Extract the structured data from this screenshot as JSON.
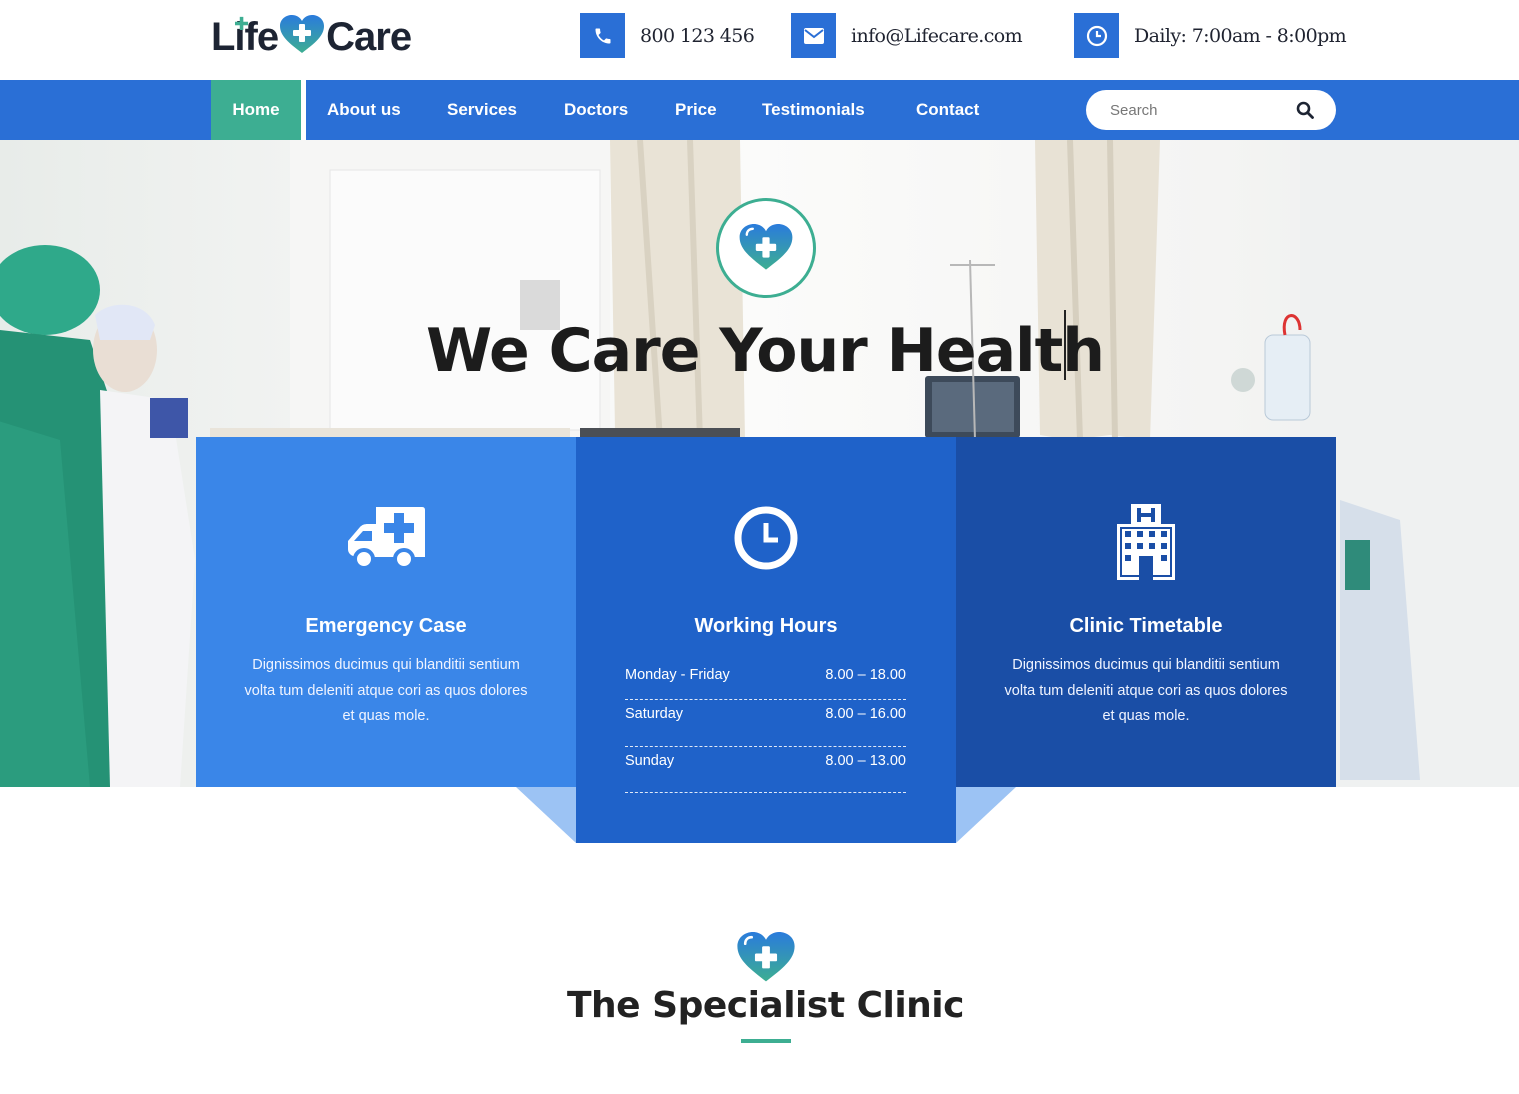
{
  "brand": {
    "logo_left": "Life",
    "logo_right": "Care"
  },
  "contacts": {
    "phone": "800 123 456",
    "email": "info@Lifecare.com",
    "hours": "Daily: 7:00am - 8:00pm"
  },
  "nav": {
    "items": [
      "Home",
      "About us",
      "Services",
      "Doctors",
      "Price",
      "Testimonials",
      "Contact"
    ],
    "active": "Home"
  },
  "search": {
    "placeholder": "Search"
  },
  "hero": {
    "title": "We Care Your Health"
  },
  "cards": [
    {
      "title": "Emergency Case",
      "text": "Dignissimos ducimus qui blanditii sentium volta tum deleniti atque cori as quos dolores et quas mole."
    },
    {
      "title": "Working Hours",
      "schedule": [
        {
          "day": "Monday - Friday",
          "time": "8.00 – 18.00"
        },
        {
          "day": "Saturday",
          "time": "8.00 – 16.00"
        },
        {
          "day": "Sunday",
          "time": "8.00 – 13.00"
        }
      ]
    },
    {
      "title": "Clinic Timetable",
      "text": "Dignissimos ducimus qui blanditii sentium volta tum deleniti atque cori as quos dolores et quas mole."
    }
  ],
  "section": {
    "title": "The Specialist Clinic"
  },
  "colors": {
    "primary": "#2a6fd6",
    "accent": "#3dae92",
    "card1": "#3a86e8",
    "card2": "#1f62c9",
    "card3": "#1a4ea6"
  },
  "icons": [
    "phone-icon",
    "mail-icon",
    "clock-icon",
    "search-icon",
    "heart-plus-icon",
    "ambulance-icon",
    "hospital-icon"
  ]
}
